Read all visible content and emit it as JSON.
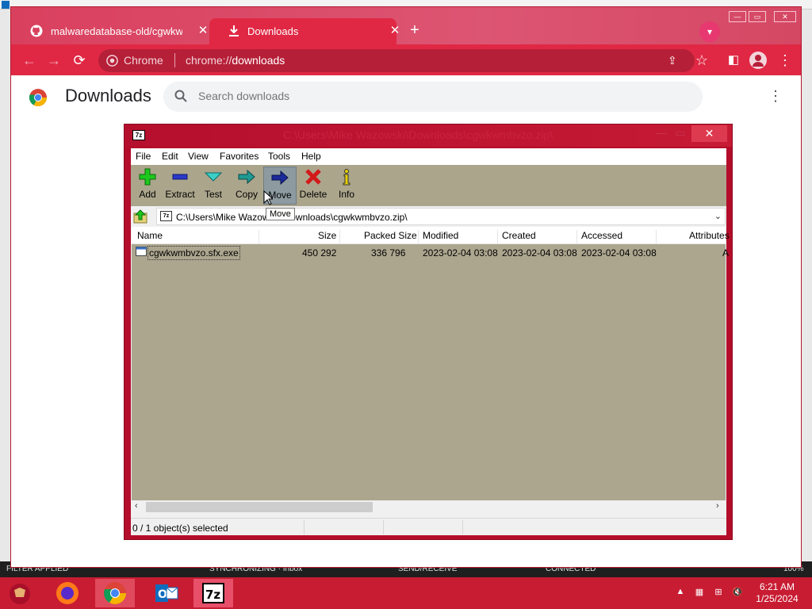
{
  "outlook": {
    "status": {
      "filter": "FILTER APPLIED",
      "sync": "SYNCHRONIZING · Inbox",
      "sendreceive": "SEND/RECEIVE",
      "connected": "CONNECTED",
      "zoom": "100%"
    }
  },
  "browser": {
    "tabs": [
      {
        "label": "malwaredatabase-old/cgwkwmb"
      },
      {
        "label": "Downloads"
      }
    ],
    "omnibox": {
      "site": "Chrome",
      "url_prefix": "chrome://",
      "url_page": "downloads"
    },
    "page": {
      "title": "Downloads",
      "search_placeholder": "Search downloads"
    }
  },
  "sevenzip": {
    "title": "C:\\Users\\Mike Wazowski\\Downloads\\cgwkwmbvzo.zip\\",
    "menu": [
      "File",
      "Edit",
      "View",
      "Favorites",
      "Tools",
      "Help"
    ],
    "toolbar": [
      {
        "label": "Add"
      },
      {
        "label": "Extract"
      },
      {
        "label": "Test"
      },
      {
        "label": "Copy"
      },
      {
        "label": "Move"
      },
      {
        "label": "Delete"
      },
      {
        "label": "Info"
      }
    ],
    "tooltip": "Move",
    "address": "C:\\Users\\Mike Wazowski\\Downloads\\cgwkwmbvzo.zip\\",
    "columns": [
      "Name",
      "Size",
      "Packed Size",
      "Modified",
      "Created",
      "Accessed",
      "Attributes"
    ],
    "rows": [
      {
        "name": "cgwkwmbvzo.sfx.exe",
        "size": "450 292",
        "packed": "336 796",
        "modified": "2023-02-04 03:08",
        "created": "2023-02-04 03:08",
        "accessed": "2023-02-04 03:08",
        "attributes": "A"
      }
    ],
    "status": "0 / 1 object(s) selected"
  },
  "taskbar": {
    "time": "6:21 AM",
    "date": "1/25/2024"
  },
  "colors": {
    "chrome_theme": "#e02844",
    "tabstrip": "#d9405e",
    "sevenzip_frame": "#b40d2b",
    "list_bg": "#aca68f",
    "taskbar": "#c81c32"
  }
}
